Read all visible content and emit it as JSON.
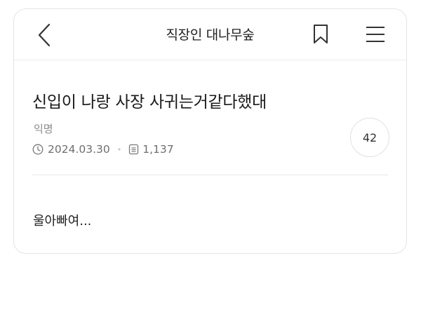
{
  "header": {
    "title": "직장인 대나무숲",
    "back_icon": "chevron-left-icon",
    "bookmark_icon": "bookmark-icon",
    "menu_icon": "hamburger-menu-icon"
  },
  "post": {
    "title": "신입이 나랑 사장 사귀는거같다했대",
    "author": "익명",
    "date": "2024.03.30",
    "separator": "•",
    "views": "1,137",
    "comment_count": "42",
    "body": "울아빠여..."
  }
}
